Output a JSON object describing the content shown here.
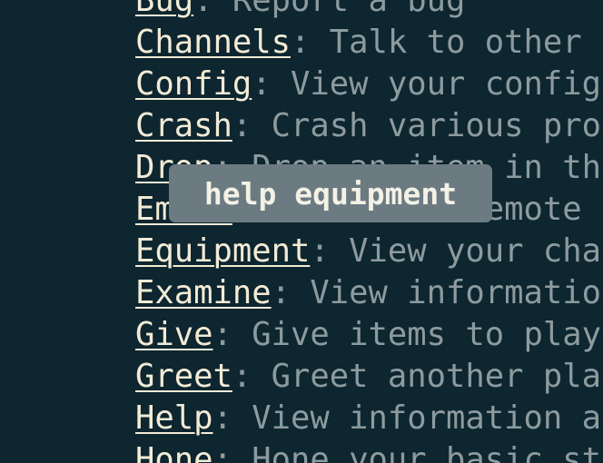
{
  "commands": [
    {
      "name": "Bug",
      "sep": ":",
      "desc": " Report a bug"
    },
    {
      "name": "Channels",
      "sep": ":",
      "desc": " Talk to other p"
    },
    {
      "name": "Config",
      "sep": ":",
      "desc": " View your config"
    },
    {
      "name": "Crash",
      "sep": ":",
      "desc": " Crash various proc"
    },
    {
      "name": "Drop",
      "sep": ":",
      "desc": " Drop an item in the"
    },
    {
      "name": "Emote",
      "sep": ":",
      "desc": " Perform a remote"
    },
    {
      "name": "Equipment",
      "sep": ":",
      "desc": " View your char"
    },
    {
      "name": "Examine",
      "sep": ":",
      "desc": " View information"
    },
    {
      "name": "Give",
      "sep": ":",
      "desc": " Give items to playe"
    },
    {
      "name": "Greet",
      "sep": ":",
      "desc": " Greet another play"
    },
    {
      "name": "Help",
      "sep": ":",
      "desc": " View information ab"
    },
    {
      "name": "Hone",
      "sep": ":",
      "desc": " Hone your basic st"
    }
  ],
  "tooltip": {
    "text": "help equipment"
  },
  "colors": {
    "background": "#0d2630",
    "command": "#f3ebd6",
    "description": "#8d9b9e",
    "tooltip_bg": "#6c7b82",
    "tooltip_text": "#f4f1e6"
  }
}
